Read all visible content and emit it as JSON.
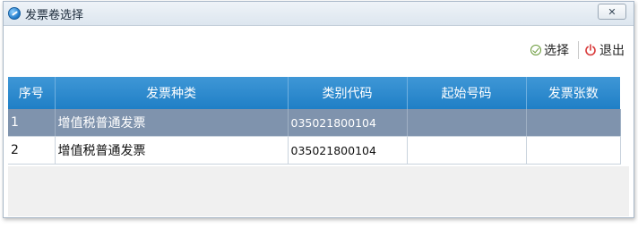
{
  "window": {
    "title": "发票卷选择",
    "close_glyph": "✕"
  },
  "toolbar": {
    "select_label": "选择",
    "exit_label": "退出"
  },
  "table": {
    "columns": [
      "序号",
      "发票种类",
      "类别代码",
      "起始号码",
      "发票张数"
    ],
    "rows": [
      {
        "index": "1",
        "type": "增值税普通发票",
        "code": "035021800104",
        "start": "",
        "count": ""
      },
      {
        "index": "2",
        "type": "增值税普通发票",
        "code": "035021800104",
        "start": "",
        "count": ""
      }
    ],
    "selected_row": 0
  },
  "colors": {
    "header": "#2a8bd0",
    "selected_row": "#7f93ad",
    "power_icon": "#d83a3a",
    "check_icon": "#6a9a3a"
  }
}
